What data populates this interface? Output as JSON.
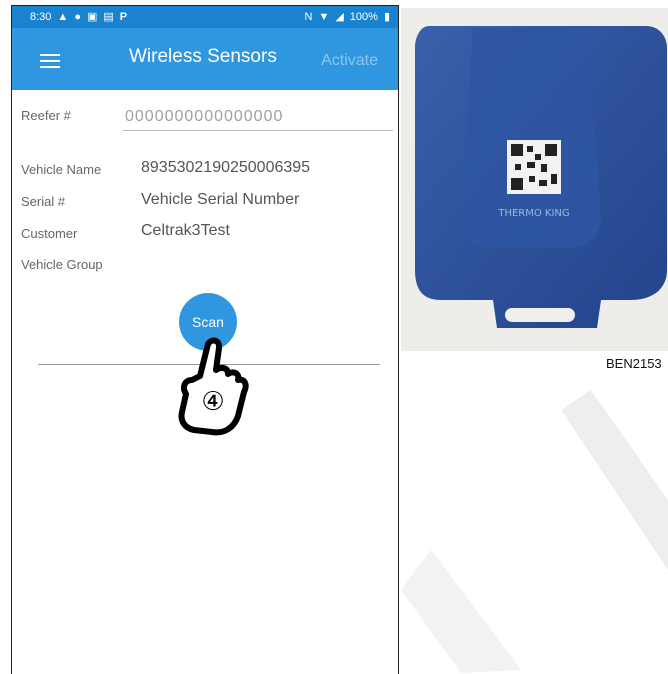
{
  "status_bar": {
    "time": "8:30",
    "icons_left": [
      "notification-icon",
      "notification-icon",
      "image-icon",
      "cast-icon",
      "parking-icon"
    ],
    "battery": "100%",
    "icons_right": [
      "nfc-icon",
      "wifi-icon",
      "signal-icon",
      "battery-icon"
    ]
  },
  "appbar": {
    "title": "Wireless Sensors",
    "action": "Activate"
  },
  "form": {
    "reefer_label": "Reefer #",
    "reefer_placeholder": "0000000000000000",
    "vehicle_name_label": "Vehicle Name",
    "vehicle_name_value": "8935302190250006395",
    "serial_label": "Serial #",
    "serial_value": "Vehicle Serial Number",
    "customer_label": "Customer",
    "customer_value": "Celtrak3Test",
    "vehicle_group_label": "Vehicle Group",
    "vehicle_group_value": ""
  },
  "scan_label": "Scan",
  "step_marker": "④",
  "photo": {
    "brand_text": "THERMO KING",
    "caption": "BEN2153"
  },
  "colors": {
    "primary": "#2f97e0",
    "status_bar": "#1a83cf",
    "sensor_blue": "#2c4f97"
  }
}
